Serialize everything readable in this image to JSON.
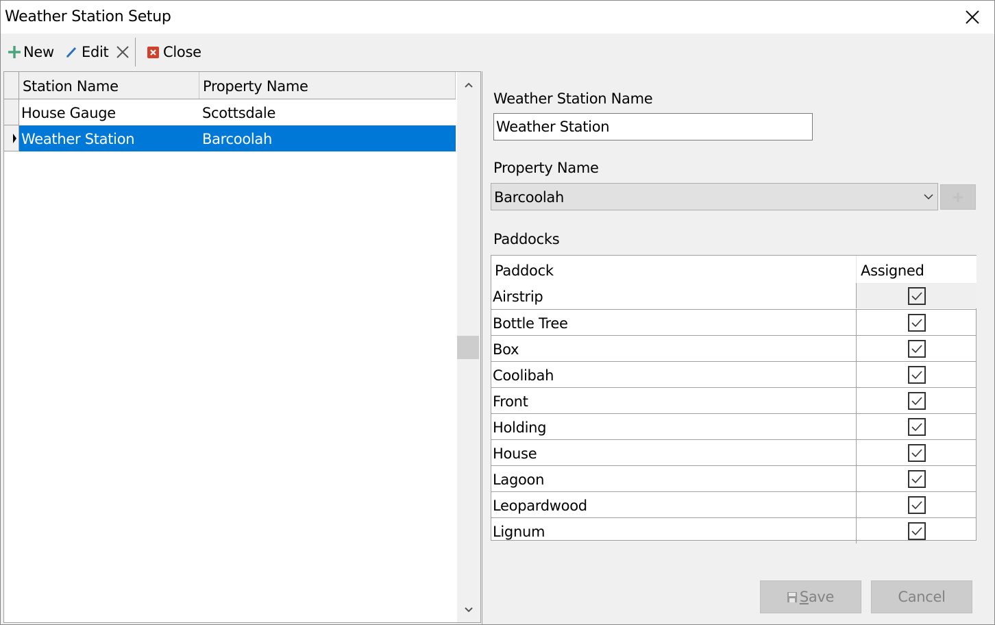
{
  "window": {
    "title": "Weather Station Setup",
    "close_icon": "close-x-icon"
  },
  "toolbar": {
    "new_label": "New",
    "new_icon": "plus-icon",
    "edit_label": "Edit",
    "edit_icon": "pencil-icon",
    "delete_icon": "x-icon",
    "close_label": "Close",
    "close_icon": "red-close-icon",
    "colors": {
      "plus": "#4aa57a",
      "pencil": "#2a6fc2",
      "close": "#d0412c"
    }
  },
  "stations_grid": {
    "columns": [
      "Station Name",
      "Property Name"
    ],
    "rows": [
      {
        "station": "House Gauge",
        "property": "Scottsdale",
        "selected": false
      },
      {
        "station": "Weather Station",
        "property": "Barcoolah",
        "selected": true
      }
    ],
    "selection_color": "#0078d7"
  },
  "details": {
    "station_name_label": "Weather Station Name",
    "station_name_value": "Weather Station",
    "property_label": "Property Name",
    "property_value": "Barcoolah",
    "paddocks_label": "Paddocks",
    "paddocks_columns": [
      "Paddock",
      "Assigned"
    ],
    "paddocks": [
      {
        "name": "Airstrip",
        "assigned": true
      },
      {
        "name": "Bottle Tree",
        "assigned": true
      },
      {
        "name": "Box",
        "assigned": true
      },
      {
        "name": "Coolibah",
        "assigned": true
      },
      {
        "name": "Front",
        "assigned": true
      },
      {
        "name": "Holding",
        "assigned": true
      },
      {
        "name": "House",
        "assigned": true
      },
      {
        "name": "Lagoon",
        "assigned": true
      },
      {
        "name": "Leopardwood",
        "assigned": true
      },
      {
        "name": "Lignum",
        "assigned": true
      }
    ]
  },
  "footer": {
    "save_label": "Save",
    "save_mnemonic": "S",
    "save_rest": "ave",
    "cancel_label": "Cancel"
  }
}
